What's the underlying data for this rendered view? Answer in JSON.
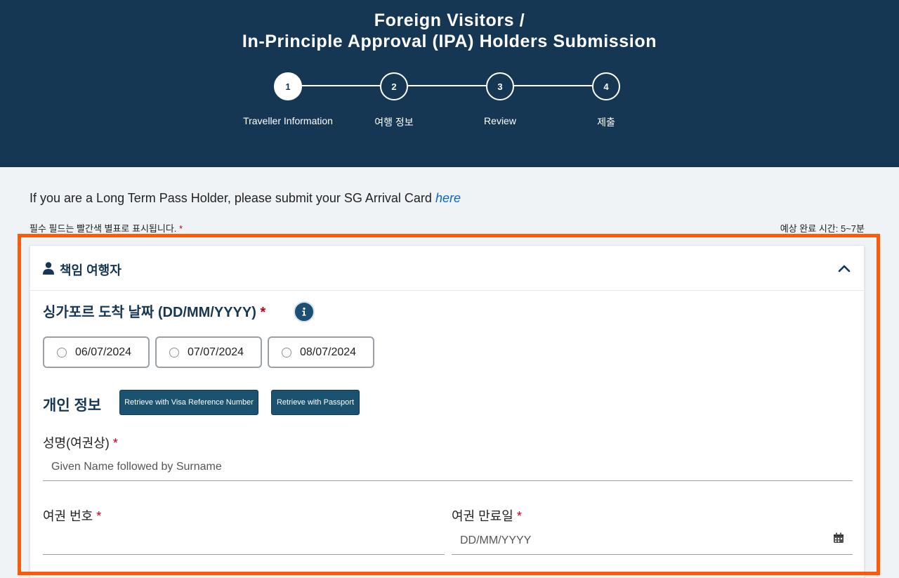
{
  "header": {
    "title_line1": "Foreign Visitors /",
    "title_line2": "In-Principle Approval (IPA) Holders Submission",
    "steps": [
      {
        "number": "1",
        "label": "Traveller Information"
      },
      {
        "number": "2",
        "label": "여행 정보"
      },
      {
        "number": "3",
        "label": "Review"
      },
      {
        "number": "4",
        "label": "제출"
      }
    ],
    "active_step": 1
  },
  "notice": {
    "text": "If you are a Long Term Pass Holder, please submit your SG Arrival Card ",
    "link": "here"
  },
  "required_note": "필수 필드는 빨간색 별표로 표시됩니다.",
  "required_star": "*",
  "time_note": "예상 완료 시간: 5~7분",
  "panel": {
    "title": "책임 여행자",
    "title_icon": "person-icon",
    "collapse_icon": "chevron-up-icon"
  },
  "arrival": {
    "label": "싱가포르 도착 날짜 (DD/MM/YYYY)",
    "options": [
      "06/07/2024",
      "07/07/2024",
      "08/07/2024"
    ],
    "info_icon": "info-icon"
  },
  "personal": {
    "title": "개인 정보",
    "retrieve_visa_label": "Retrieve with Visa Reference Number",
    "retrieve_passport_label": "Retrieve with Passport"
  },
  "fields": {
    "name_label": "성명(여권상)",
    "name_placeholder": "Given Name followed by Surname",
    "passport_label": "여권 번호",
    "passport_value": "",
    "expiry_label": "여권 만료일",
    "expiry_placeholder": "DD/MM/YYYY",
    "calendar_icon": "calendar-icon"
  },
  "colors": {
    "header_bg": "#163754",
    "accent": "#1a5270",
    "required": "#c0001a",
    "highlight": "#ff5a0a",
    "link": "#0a66c2"
  }
}
